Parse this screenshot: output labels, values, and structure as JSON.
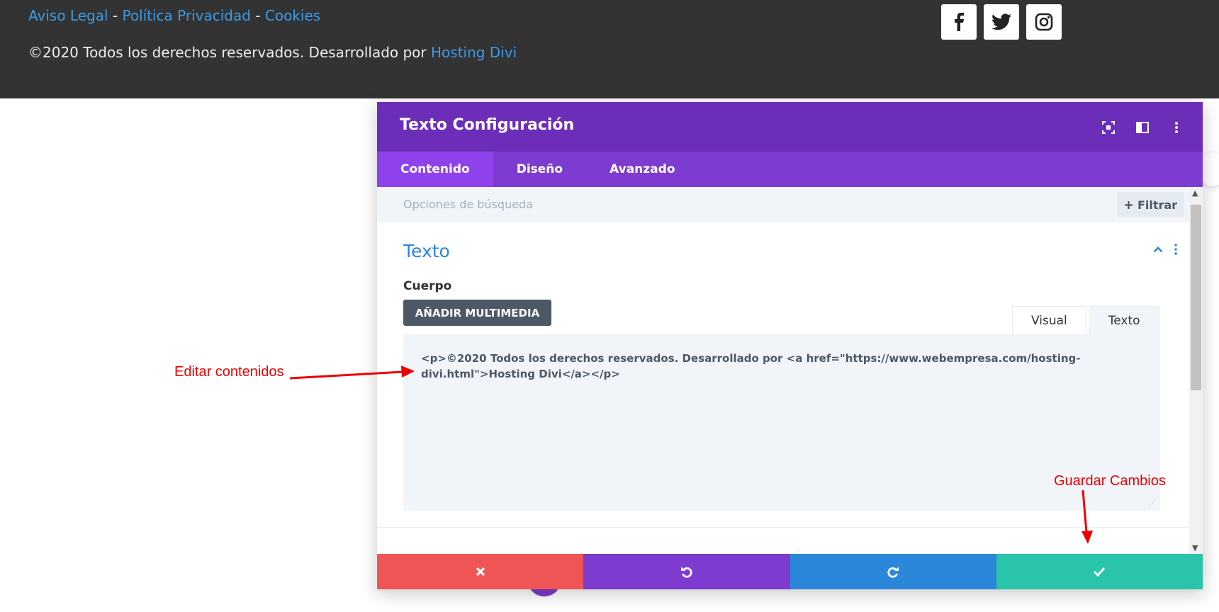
{
  "footer": {
    "links": [
      "Aviso Legal",
      "Política Privacidad",
      "Cookies"
    ],
    "separator": " - ",
    "copyright_text": "©2020 Todos los derechos reservados. Desarrollado por ",
    "copyright_link": "Hosting Divi",
    "social_icons": [
      "facebook-icon",
      "twitter-icon",
      "instagram-icon"
    ]
  },
  "modal": {
    "title": "Texto Configuración",
    "header_icons": [
      "fullscreen-icon",
      "sidebar-layout-icon",
      "more-options-icon"
    ],
    "tabs": [
      {
        "label": "Contenido",
        "active": true
      },
      {
        "label": "Diseño",
        "active": false
      },
      {
        "label": "Avanzado",
        "active": false
      }
    ],
    "search": {
      "placeholder": "Opciones de búsqueda",
      "filter_label": "Filtrar"
    },
    "section": {
      "title": "Texto",
      "field_label": "Cuerpo",
      "media_button": "AÑADIR MULTIMEDIA",
      "editor_tabs": [
        "Visual",
        "Texto"
      ],
      "active_editor_tab": "Texto",
      "content": "<p>©2020 Todos los derechos reservados. Desarrollado por <a href=\"https://www.webempresa.com/hosting-divi.html\">Hosting Divi</a></p>"
    },
    "footer_buttons": [
      "discard-icon",
      "undo-icon",
      "redo-icon",
      "save-check-icon"
    ],
    "colors": {
      "header": "#6c2eb9",
      "tabs": "#7e3bd0",
      "discard": "#ef5555",
      "undo": "#7e3bd0",
      "redo": "#2b87da",
      "save": "#29c4a9"
    }
  },
  "annotations": {
    "edit_label": "Editar contenidos",
    "save_label": "Guardar Cambios"
  }
}
